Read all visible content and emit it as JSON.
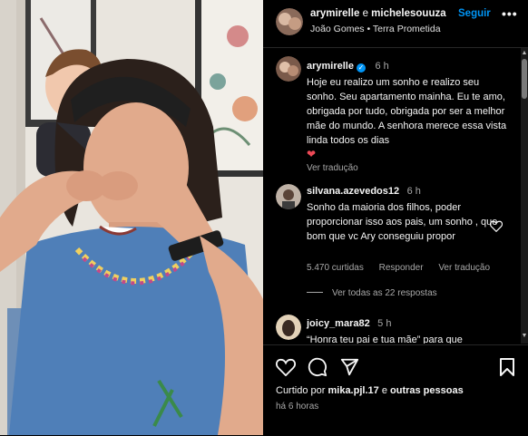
{
  "header": {
    "user1": "arymirelle",
    "conj": "e",
    "user2": "michelesouuza",
    "follow_label": "Seguir",
    "more_label": "•••",
    "subtitle": "João Gomes • Terra Prometida"
  },
  "caption": {
    "username": "arymirelle",
    "time": "6 h",
    "text": "Hoje eu realizo um sonho e realizo seu sonho. Seu apartamento mainha. Eu te amo, obrigada por tudo, obrigada por ser a melhor mãe do mundo. A senhora merece essa vista linda todos os dias",
    "heart": "❤",
    "translate_label": "Ver tradução"
  },
  "comments": [
    {
      "username": "silvana.azevedos12",
      "time": "6 h",
      "text": "Sonho da maioria dos filhos, poder proporcionar isso aos pais, um sonho , que bom que vc Ary conseguiu propor",
      "likes": "5.470 curtidas",
      "reply_label": "Responder",
      "translate_label": "Ver tradução",
      "view_replies": "Ver todas as 22 respostas"
    },
    {
      "username": "joicy_mara82",
      "time": "5 h",
      "text": "“Honra teu pai e tua mãe” para que"
    }
  ],
  "footer": {
    "liked_prefix": "Curtido por",
    "liked_user": "mika.pjl.17",
    "liked_conj": "e",
    "liked_others": "outras pessoas",
    "time_ago": "há 6 horas"
  },
  "colors": {
    "accent": "#0095f6",
    "heart": "#ed4956",
    "muted": "#a8a8a8"
  },
  "icons": [
    "heart-icon",
    "comment-icon",
    "share-icon",
    "bookmark-icon",
    "verified-icon",
    "like-comment-icon",
    "more-icon"
  ]
}
